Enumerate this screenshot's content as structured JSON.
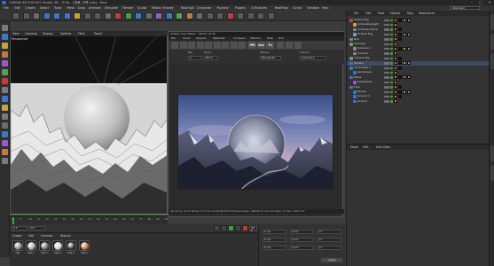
{
  "window": {
    "title": "CINEMA 4D R16.041 Studio (RC - R16) - [场景_平移.c4d] - Main",
    "layout_label": "Standard"
  },
  "menubar": {
    "items": [
      "File",
      "Edit",
      "Create",
      "Select",
      "Tools",
      "Mesh",
      "Snap",
      "Animate",
      "Simulate",
      "Render",
      "Sculpt",
      "Motion Tracker",
      "MoGraph",
      "Character",
      "Pipeline",
      "Plugins",
      "X-Particles",
      "RealFlow",
      "Script",
      "Window",
      "Help"
    ]
  },
  "viewport": {
    "menu": [
      "View",
      "Cameras",
      "Display",
      "Options",
      "Filter",
      "Panel"
    ],
    "label": "Perspective"
  },
  "timeline": {
    "ticks": [
      "0",
      "5",
      "10",
      "15",
      "20",
      "25",
      "30",
      "35",
      "40",
      "45",
      "50",
      "55",
      "60",
      "65",
      "70",
      "75",
      "80",
      "85",
      "90"
    ]
  },
  "playback": {
    "start": "0 F",
    "current": "0 F",
    "end": "90 F"
  },
  "material_manager": {
    "menu": [
      "Create",
      "Edit",
      "Function",
      "Texture"
    ],
    "materials": [
      {
        "name": "Mat",
        "color": "#8a8a8a"
      },
      {
        "name": "Mat.1",
        "color": "#b0b0b0"
      },
      {
        "name": "Mat.2",
        "color": "#6f6f6f"
      },
      {
        "name": "Mat.3",
        "color": "#d4d4d4"
      },
      {
        "name": "Mat.4",
        "color": "#3a3a3a"
      },
      {
        "name": "Mat.5",
        "color": "#c07a3a"
      }
    ]
  },
  "coordinates": {
    "apply_label": "Apply",
    "fields": [
      "0 cm",
      "0 cm",
      "0 cm",
      "0 cm",
      "0 cm",
      "0 cm",
      "0 °",
      "0 °",
      "0 °"
    ]
  },
  "ir_window": {
    "title": "Octane Live Viewer - Studio v2.25",
    "menu": [
      "File",
      "Cloud",
      "Objects",
      "Materials",
      "Compare",
      "Options",
      "Help",
      "GUI"
    ],
    "tool_labels": [
      "IPR",
      "Ass",
      "Tx"
    ],
    "settings": {
      "labels": [
        "Res",
        "Zoom",
        "Display",
        "Camera"
      ],
      "values": [
        "1",
        "80 %",
        "Beauty Pa",
        "Camera.1"
      ]
    },
    "status": "Rendering: 34.2% Ms/sec: 6.9 Time: 00:00:06/00:00:18 Spp/maxspp: 108/256 Tri: 0/1.04m Mesh: 11 Hair: 0 GPU: 54°"
  },
  "objects_panel": {
    "tabs": [
      "File",
      "Edit",
      "View",
      "Objects",
      "Tags",
      "Bookmarks"
    ],
    "rows": [
      {
        "name": "Octane Sky",
        "indent": 0,
        "icon": "#c83c3c"
      },
      {
        "name": "OctaneDayLight",
        "indent": 1,
        "icon": "#d6a33b"
      },
      {
        "name": "OctaneCamera",
        "indent": 1,
        "icon": "#8a8a8a"
      },
      {
        "name": "Octane Fog",
        "indent": 1,
        "icon": "#7aa0c8"
      },
      {
        "name": "Null",
        "indent": 0,
        "icon": "#5aa05a"
      },
      {
        "name": "Cameras",
        "indent": 0,
        "icon": "#8a8a8a"
      },
      {
        "name": "Camera.1",
        "indent": 1,
        "icon": "#8a8a8a"
      },
      {
        "name": "Camera",
        "indent": 1,
        "icon": "#8a8a8a"
      },
      {
        "name": "Camera Rig",
        "indent": 0,
        "icon": "#8a8a8a"
      },
      {
        "name": "Sphere",
        "indent": 0,
        "icon": "#3c78c8"
      },
      {
        "name": "Landscape.1",
        "indent": 0,
        "icon": "#3c78c8"
      },
      {
        "name": "Landscape",
        "indent": 1,
        "icon": "#3c78c8"
      },
      {
        "name": "Plane",
        "indent": 0,
        "icon": "#3c78c8"
      },
      {
        "name": "Subdivision",
        "indent": 1,
        "icon": "#9a5ac8"
      },
      {
        "name": "Floor",
        "indent": 0,
        "icon": "#3c78c8"
      },
      {
        "name": "Terrain",
        "indent": 1,
        "icon": "#3c78c8"
      },
      {
        "name": "Ground.1",
        "indent": 1,
        "icon": "#3c78c8"
      },
      {
        "name": "Ground",
        "indent": 1,
        "icon": "#3c78c8"
      }
    ]
  },
  "attributes_panel": {
    "tabs": [
      "Mode",
      "Edit",
      "User Data"
    ]
  },
  "colors": {
    "accent": "#2a70c8",
    "timeline_marker": "#3aa53a",
    "ir_title_red": "#c0392b"
  }
}
